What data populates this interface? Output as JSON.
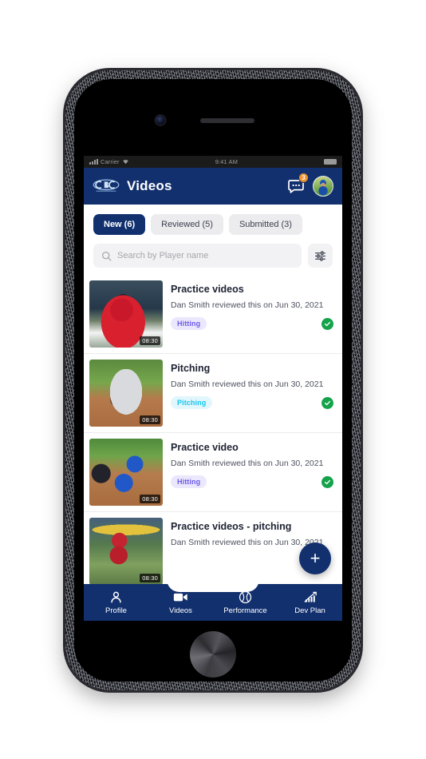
{
  "status_bar": {
    "carrier": "Carrier",
    "time": "9:41 AM",
    "signal_icon": "signal-bars-icon",
    "wifi_icon": "wifi-icon",
    "battery_icon": "battery-icon"
  },
  "header": {
    "logo_alt": "cbc-logo",
    "title": "Videos",
    "messages_icon": "messages-icon",
    "messages_badge": "3",
    "avatar_alt": "user-avatar"
  },
  "tabs": [
    {
      "label": "New (6)",
      "active": true
    },
    {
      "label": "Reviewed (5)",
      "active": false
    },
    {
      "label": "Submitted (3)",
      "active": false
    }
  ],
  "search": {
    "placeholder": "Search by Player name",
    "value": "",
    "icon": "search-icon",
    "filter_icon": "filter-sliders-icon"
  },
  "videos": [
    {
      "title": "Practice videos",
      "subtitle": "Dan Smith reviewed this on Jun 30, 2021",
      "tag": "Hitting",
      "tag_bg": "#ebe7fd",
      "tag_color": "#6c5ce7",
      "duration": "08:30",
      "reviewed": true
    },
    {
      "title": "Pitching",
      "subtitle": "Dan Smith reviewed this on Jun 30, 2021",
      "tag": "Pitching",
      "tag_bg": "#e2f7fd",
      "tag_color": "#16c5ee",
      "duration": "08:30",
      "reviewed": true
    },
    {
      "title": "Practice video",
      "subtitle": "Dan Smith reviewed this on Jun 30, 2021",
      "tag": "Hitting",
      "tag_bg": "#ebe7fd",
      "tag_color": "#6c5ce7",
      "duration": "08:30",
      "reviewed": true
    },
    {
      "title": "Practice videos - pitching",
      "subtitle": "Dan Smith reviewed this on Jun 30, 2021",
      "tag": "",
      "tag_bg": "#ebe7fd",
      "tag_color": "#6c5ce7",
      "duration": "08:30",
      "reviewed": true
    }
  ],
  "fab": {
    "label": "+",
    "icon": "plus-icon"
  },
  "bottom_nav": [
    {
      "label": "Profile",
      "icon": "person-icon",
      "active": false
    },
    {
      "label": "Videos",
      "icon": "video-camera-icon",
      "active": true
    },
    {
      "label": "Performance",
      "icon": "baseball-icon",
      "active": false
    },
    {
      "label": "Dev Plan",
      "icon": "bar-chart-icon",
      "active": false
    }
  ],
  "theme": {
    "navy": "#12306e",
    "accent_orange": "#f0932b",
    "green_check": "#14a34a",
    "screen_bg": "#ffffff"
  }
}
